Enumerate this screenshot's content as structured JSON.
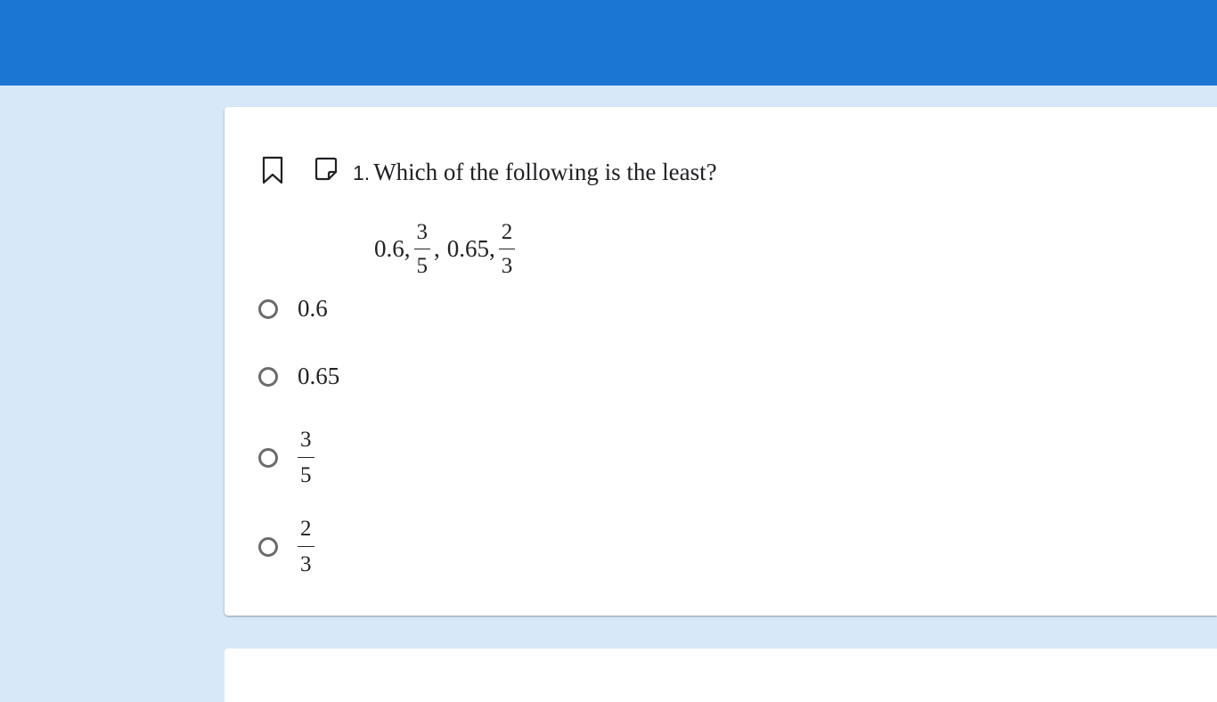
{
  "question": {
    "number": "1.",
    "text": "Which of the following is the least?",
    "expression": {
      "a": "0.6,",
      "frac1": {
        "num": "3",
        "den": "5"
      },
      "sep": ",",
      "b": "0.65,",
      "frac2": {
        "num": "2",
        "den": "3"
      }
    }
  },
  "options": [
    {
      "label": "0.6"
    },
    {
      "label": "0.65"
    },
    {
      "num": "3",
      "den": "5"
    },
    {
      "num": "2",
      "den": "3"
    }
  ],
  "icons": {
    "bookmark": "bookmark-icon",
    "note": "note-icon"
  },
  "colors": {
    "header": "#1a76d2",
    "background": "#d7e9f9",
    "card": "#ffffff"
  }
}
